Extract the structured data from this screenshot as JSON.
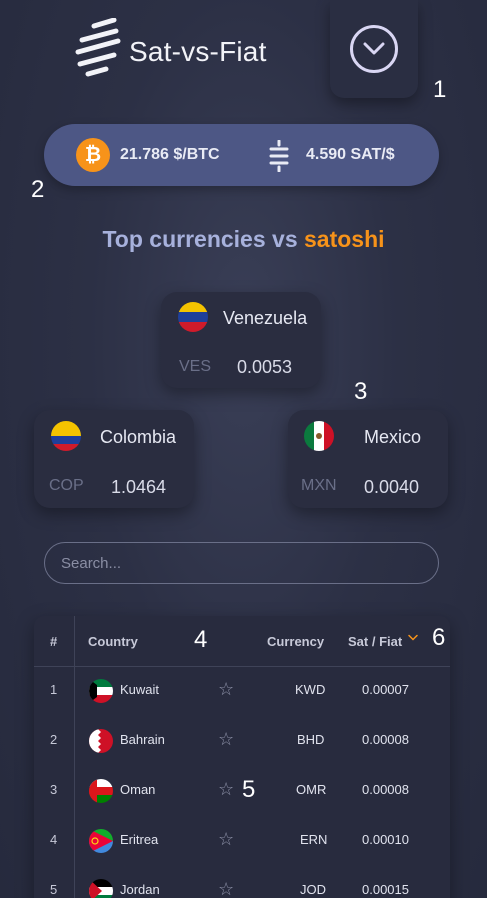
{
  "app": {
    "title": "Sat-vs-Fiat"
  },
  "menu": {
    "icon": "chevron-down-icon"
  },
  "markers": [
    "1",
    "2",
    "3",
    "4",
    "5",
    "6"
  ],
  "prices": {
    "btc_icon": "₿",
    "btc_price": "21.786 $/BTC",
    "sat_price": "4.590 SAT/$"
  },
  "section": {
    "title_prefix": "Top currencies vs ",
    "title_accent": "satoshi"
  },
  "top_cards": [
    {
      "country": "Venezuela",
      "code": "VES",
      "value": "0.0053"
    },
    {
      "country": "Colombia",
      "code": "COP",
      "value": "1.0464"
    },
    {
      "country": "Mexico",
      "code": "MXN",
      "value": "0.0040"
    }
  ],
  "search": {
    "placeholder": "Search..."
  },
  "table": {
    "headers": {
      "index": "#",
      "country": "Country",
      "currency": "Currency",
      "rate": "Sat / Fiat"
    },
    "rows": [
      {
        "index": "1",
        "country": "Kuwait",
        "currency": "KWD",
        "rate": "0.00007"
      },
      {
        "index": "2",
        "country": "Bahrain",
        "currency": "BHD",
        "rate": "0.00008"
      },
      {
        "index": "3",
        "country": "Oman",
        "currency": "OMR",
        "rate": "0.00008"
      },
      {
        "index": "4",
        "country": "Eritrea",
        "currency": "ERN",
        "rate": "0.00010"
      },
      {
        "index": "5",
        "country": "Jordan",
        "currency": "JOD",
        "rate": "0.00015"
      }
    ],
    "star_glyph": "☆"
  },
  "colors": {
    "accent": "#f7931a",
    "pill": "#4d5785",
    "title": "#a7b1dc"
  }
}
